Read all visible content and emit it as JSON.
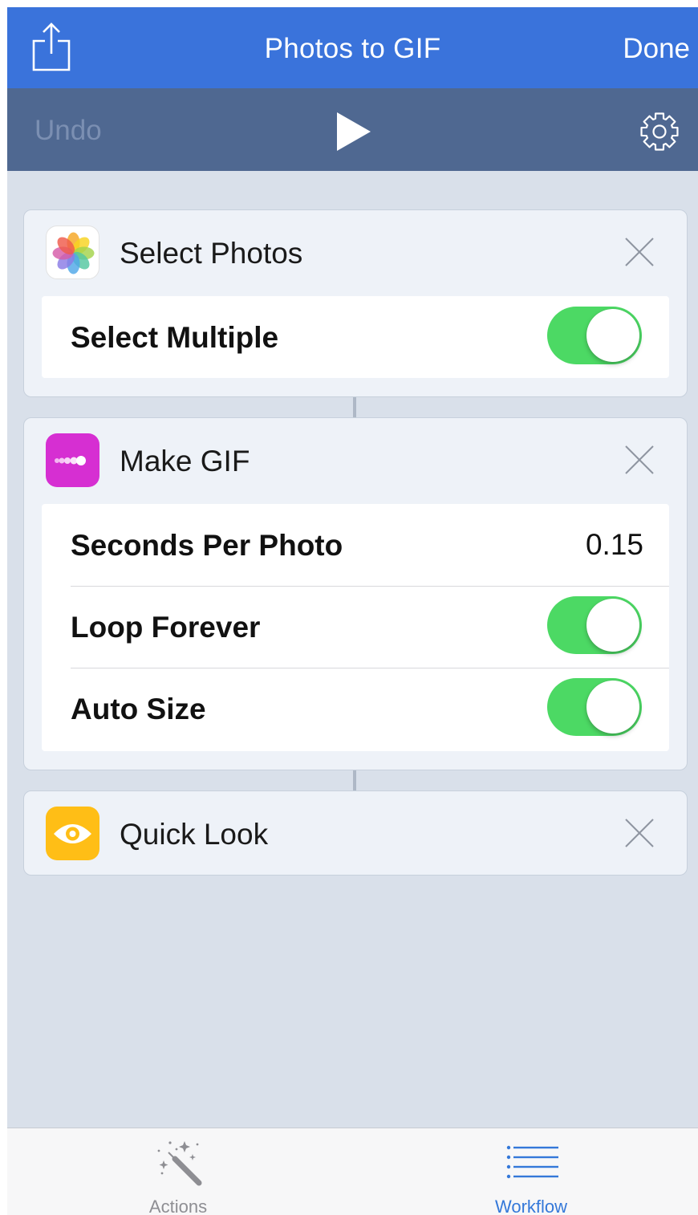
{
  "nav": {
    "title": "Photos to GIF",
    "done_label": "Done",
    "share_icon": "share-icon"
  },
  "toolbar": {
    "undo_label": "Undo",
    "play_icon": "play-icon",
    "settings_icon": "gear-icon"
  },
  "actions": [
    {
      "title": "Select Photos",
      "icon": "photos-app-icon",
      "params": [
        {
          "label": "Select Multiple",
          "type": "toggle",
          "on": true
        }
      ]
    },
    {
      "title": "Make GIF",
      "icon": "make-gif-icon",
      "params": [
        {
          "label": "Seconds Per Photo",
          "type": "value",
          "value": "0.15"
        },
        {
          "label": "Loop Forever",
          "type": "toggle",
          "on": true
        },
        {
          "label": "Auto Size",
          "type": "toggle",
          "on": true
        }
      ]
    },
    {
      "title": "Quick Look",
      "icon": "quick-look-eye-icon",
      "params": []
    }
  ],
  "tabbar": {
    "tabs": [
      {
        "label": "Actions",
        "icon": "magic-wand-icon",
        "selected": false
      },
      {
        "label": "Workflow",
        "icon": "list-icon",
        "selected": true
      }
    ]
  },
  "colors": {
    "nav_bar": "#3a73db",
    "toolbar": "#4f6891",
    "background": "#d9e0ea",
    "toggle_on": "#4cd964",
    "tab_selected": "#3478d9",
    "make_gif_icon": "#d62fd2",
    "quick_look_icon": "#ffbe16"
  }
}
